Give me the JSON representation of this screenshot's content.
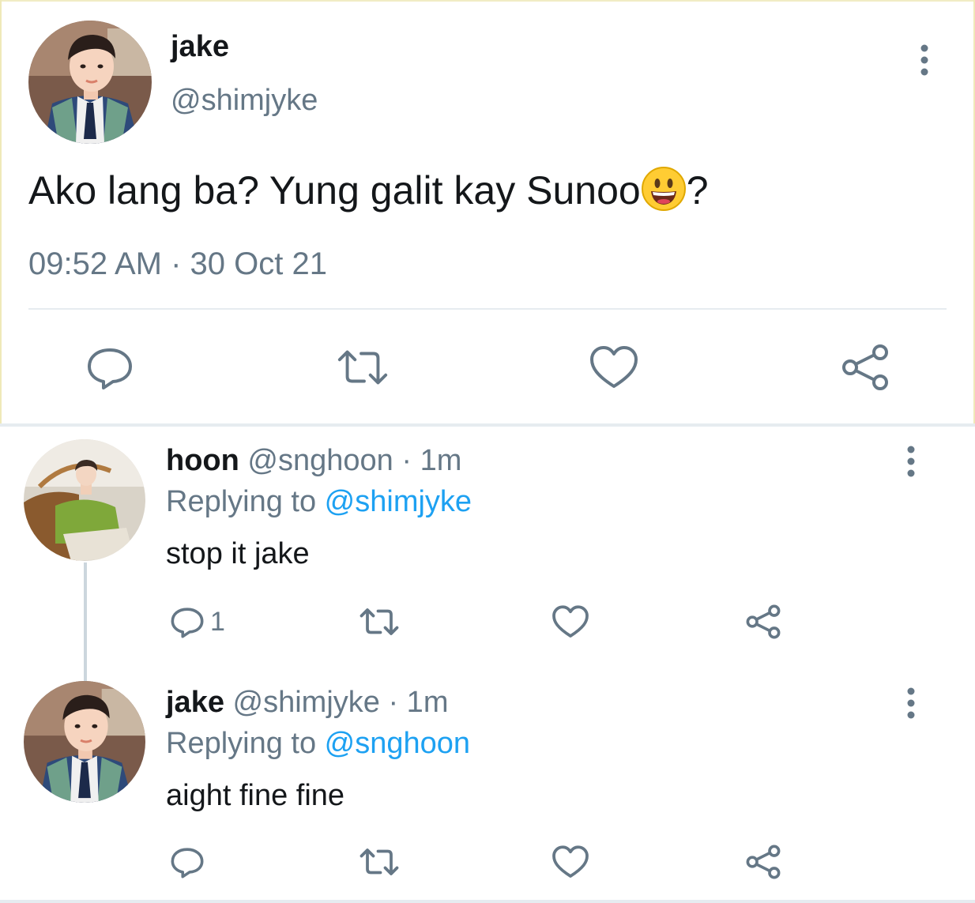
{
  "main_tweet": {
    "name": "jake",
    "handle": "@shimjyke",
    "text_before": "Ako lang ba? Yung galit kay Sunoo",
    "emoji": "grinning-face-emoji",
    "text_after": "?",
    "timestamp": "09:52 AM · 30 Oct 21",
    "actions": [
      "reply-icon",
      "retweet-icon",
      "like-icon",
      "share-icon"
    ]
  },
  "replies": [
    {
      "name": "hoon",
      "handle": "@snghoon · 1m",
      "replying_prefix": "Replying to ",
      "replying_to": "@shimjyke",
      "text": "stop it jake",
      "reply_count": "1"
    },
    {
      "name": "jake",
      "handle": "@shimjyke · 1m",
      "replying_prefix": "Replying to ",
      "replying_to": "@snghoon",
      "text": "aight fine fine",
      "reply_count": ""
    }
  ],
  "colors": {
    "text": "#14171a",
    "secondary": "#657786",
    "link": "#1da1f2",
    "icon": "#657786",
    "divider": "#e6ecf0"
  }
}
